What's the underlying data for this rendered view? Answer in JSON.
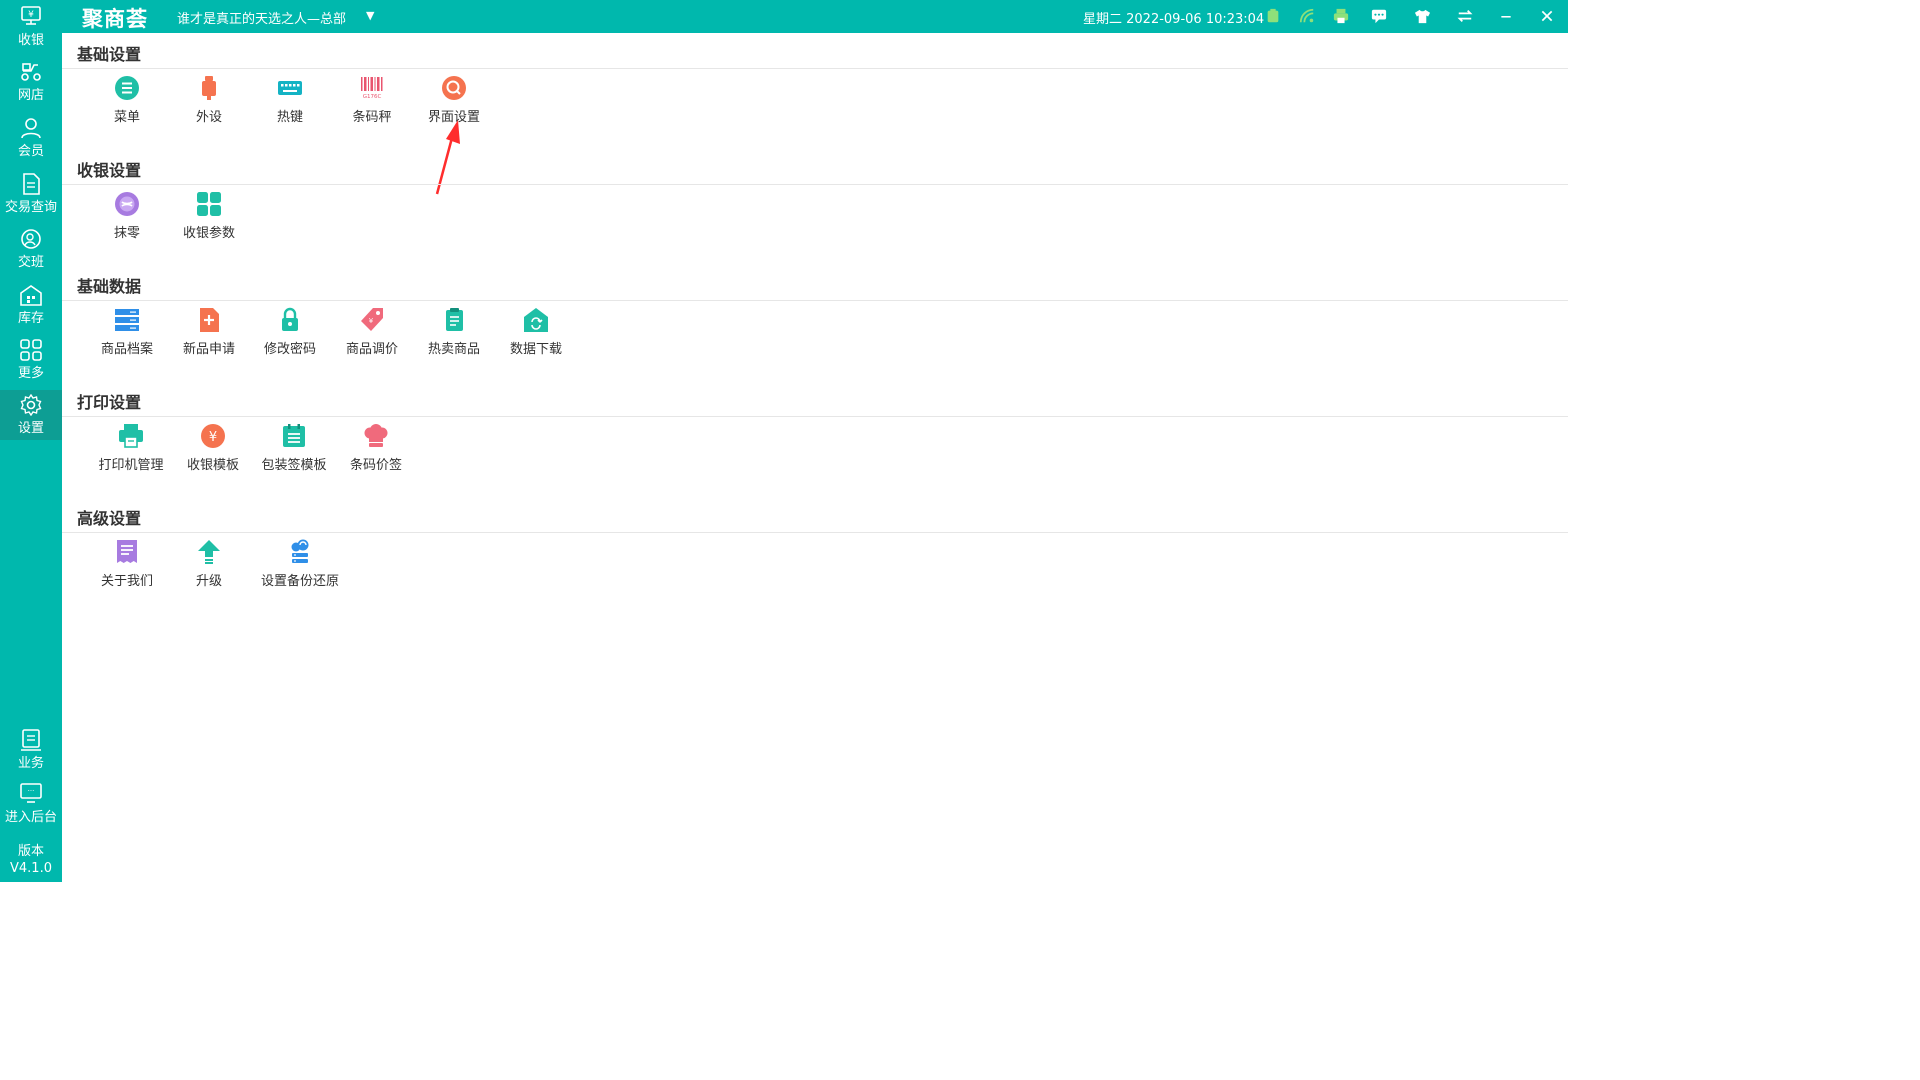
{
  "app": {
    "brand": "聚商荟",
    "store": "谁才是真正的天选之人—总部",
    "datetime": "星期二 2022-09-06 10:23:04"
  },
  "topbar_icons": [
    "battery-icon",
    "wifi-icon",
    "printer-icon",
    "message-icon",
    "skin-icon",
    "switch-icon",
    "minimize-icon",
    "close-icon"
  ],
  "sidebar": {
    "items": [
      {
        "label": "收银",
        "icon": "cashier-icon"
      },
      {
        "label": "网店",
        "icon": "delivery-icon"
      },
      {
        "label": "会员",
        "icon": "member-icon"
      },
      {
        "label": "交易查询",
        "icon": "document-icon"
      },
      {
        "label": "交班",
        "icon": "shift-icon"
      },
      {
        "label": "库存",
        "icon": "warehouse-icon"
      },
      {
        "label": "更多",
        "icon": "grid-icon"
      },
      {
        "label": "设置",
        "icon": "gear-icon"
      },
      {
        "label": "业务",
        "icon": "business-icon"
      },
      {
        "label": "进入后台",
        "icon": "monitor-icon"
      }
    ],
    "version_label": "版本",
    "version": "V4.1.0"
  },
  "sections": [
    {
      "title": "基础设置",
      "items": [
        {
          "label": "菜单",
          "icon": "menu-list-icon",
          "color": "#1fbfa6"
        },
        {
          "label": "外设",
          "icon": "usb-device-icon",
          "color": "#f5734f"
        },
        {
          "label": "热键",
          "icon": "keyboard-icon",
          "color": "#14b3c4"
        },
        {
          "label": "条码秤",
          "icon": "barcode-icon",
          "color": "#e9556f",
          "code": "G176C"
        },
        {
          "label": "界面设置",
          "icon": "search-circle-icon",
          "color": "#f5734f"
        }
      ]
    },
    {
      "title": "收银设置",
      "items": [
        {
          "label": "抹零",
          "icon": "coin-icon",
          "color": "#a77be0"
        },
        {
          "label": "收银参数",
          "icon": "tiles-icon",
          "color": "#1fbfa6"
        }
      ]
    },
    {
      "title": "基础数据",
      "items": [
        {
          "label": "商品档案",
          "icon": "server-icon",
          "color": "#2f8fe8"
        },
        {
          "label": "新品申请",
          "icon": "add-file-icon",
          "color": "#f5734f"
        },
        {
          "label": "修改密码",
          "icon": "lock-icon",
          "color": "#1fbfa6"
        },
        {
          "label": "商品调价",
          "icon": "price-tag-icon",
          "color": "#f06a7c"
        },
        {
          "label": "热卖商品",
          "icon": "hot-list-icon",
          "color": "#1fbfa6"
        },
        {
          "label": "数据下载",
          "icon": "download-home-icon",
          "color": "#1fbfa6"
        }
      ]
    },
    {
      "title": "打印设置",
      "items": [
        {
          "label": "打印机管理",
          "icon": "printer-manage-icon",
          "color": "#1fbfa6"
        },
        {
          "label": "收银模板",
          "icon": "yuan-circle-icon",
          "color": "#f5734f"
        },
        {
          "label": "包装签模板",
          "icon": "calendar-icon",
          "color": "#1fbfa6"
        },
        {
          "label": "条码价签",
          "icon": "chef-hat-icon",
          "color": "#f06a7c"
        }
      ]
    },
    {
      "title": "高级设置",
      "items": [
        {
          "label": "关于我们",
          "icon": "receipt-icon",
          "color": "#a77be0"
        },
        {
          "label": "升级",
          "icon": "upgrade-arrow-icon",
          "color": "#1fbfa6"
        },
        {
          "label": "设置备份还原",
          "icon": "cloud-backup-icon",
          "color": "#2f8fe8"
        }
      ]
    }
  ],
  "annotation": {
    "color": "#ff2d2d",
    "icon": "red-arrow-icon"
  }
}
